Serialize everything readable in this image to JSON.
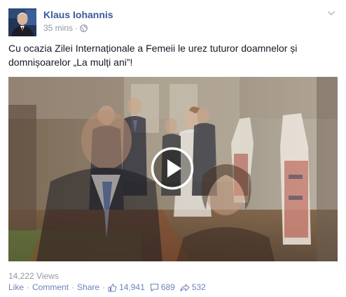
{
  "post": {
    "author": "Klaus Iohannis",
    "time": "35 mins",
    "separator": "·",
    "privacy_icon": "globe-icon",
    "options_icon": "chevron-down-icon",
    "message": "Cu ocazia Zilei Internaționale a Femeii le urez tuturor doamnelor și domnișoarelor „La mulți ani”!",
    "video": {
      "play_icon": "play-icon"
    },
    "views": "14,222 Views",
    "actions": {
      "like": "Like",
      "comment": "Comment",
      "share": "Share",
      "dot": "·"
    },
    "stats": {
      "likes": "14,941",
      "comments": "689",
      "shares": "532"
    }
  },
  "colors": {
    "link": "#3b5998",
    "muted": "#9197a3",
    "action": "#6d84b4",
    "text": "#141823"
  }
}
